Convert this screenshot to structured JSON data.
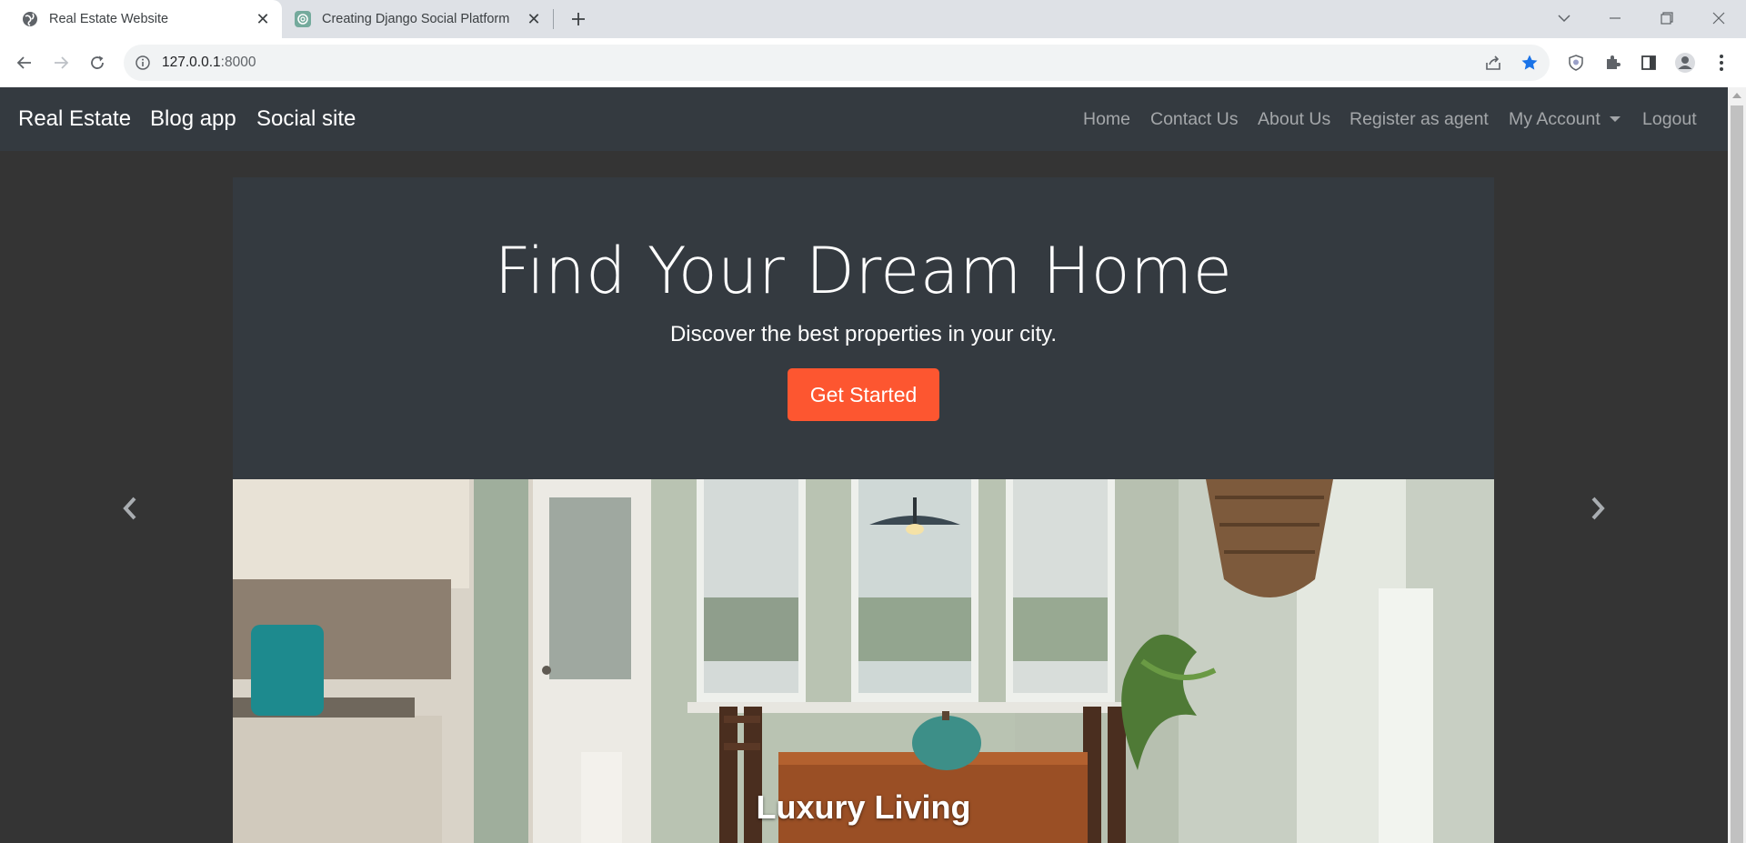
{
  "browser": {
    "tabs": [
      {
        "title": "Real Estate Website",
        "active": true,
        "icon": "globe-icon"
      },
      {
        "title": "Creating Django Social Platform",
        "active": false,
        "icon": "chatgpt-icon"
      }
    ],
    "address": {
      "host": "127.0.0.1",
      "port": ":8000"
    }
  },
  "navbar": {
    "brands": [
      "Real Estate",
      "Blog app",
      "Social site"
    ],
    "links": [
      "Home",
      "Contact Us",
      "About Us",
      "Register as agent",
      "My Account",
      "Logout"
    ]
  },
  "hero": {
    "title": "Find Your Dream Home",
    "subtitle": "Discover the best properties in your city.",
    "cta": "Get Started"
  },
  "carousel": {
    "caption": "Luxury Living"
  },
  "colors": {
    "navbar_bg": "#343a40",
    "page_bg": "#343434",
    "cta_bg": "#fd5630",
    "bookmark_star": "#1a73e8"
  }
}
